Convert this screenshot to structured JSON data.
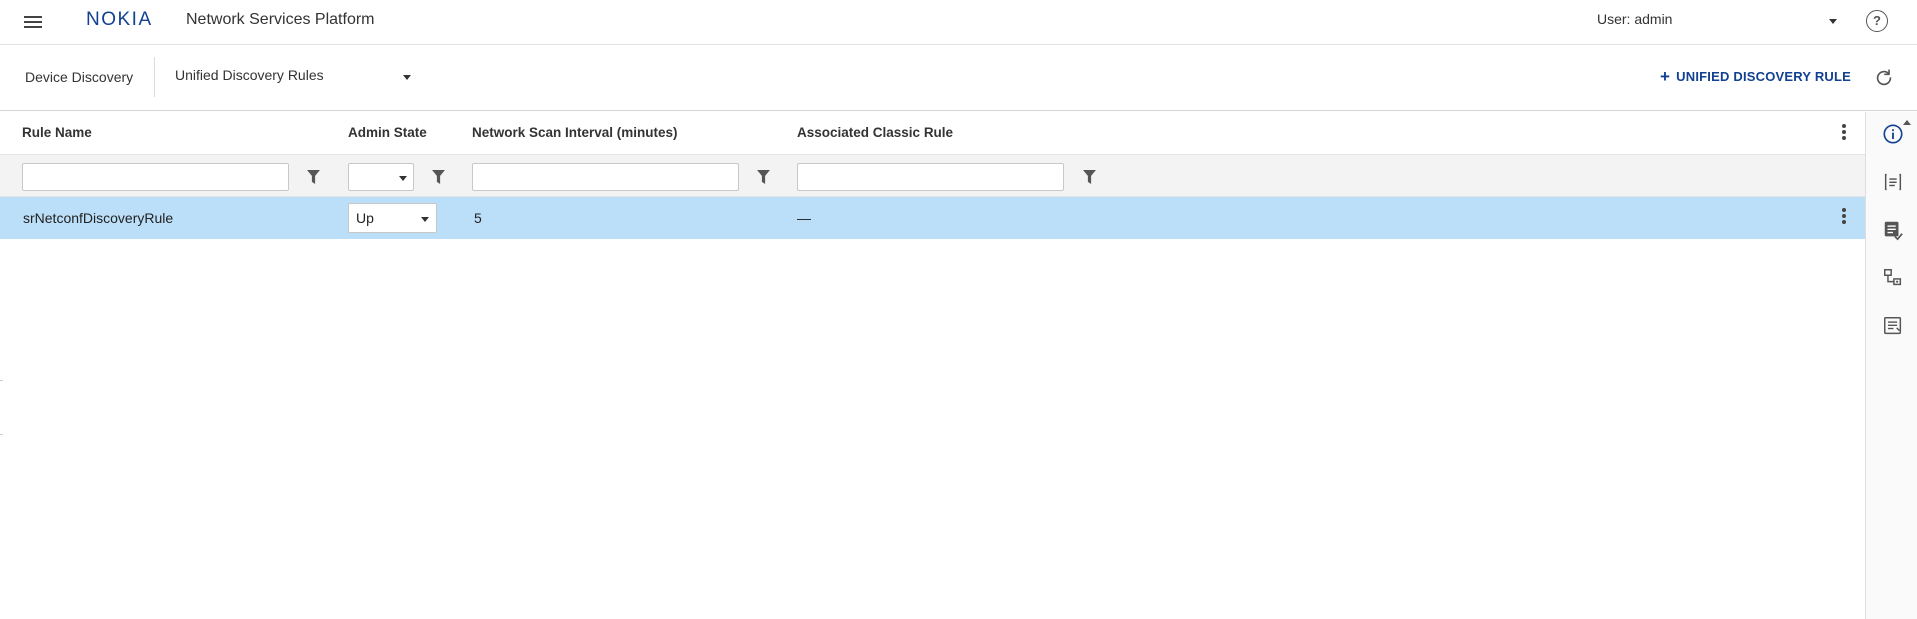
{
  "header": {
    "logo_text": "NOKIA",
    "app_title": "Network Services Platform",
    "user_label": "User: admin"
  },
  "toolbar": {
    "breadcrumb": "Device Discovery",
    "view_selected": "Unified Discovery Rules",
    "add_button_label": "UNIFIED DISCOVERY RULE"
  },
  "table": {
    "columns": [
      {
        "label": "Rule Name"
      },
      {
        "label": "Admin State"
      },
      {
        "label": "Network Scan Interval (minutes)"
      },
      {
        "label": "Associated Classic Rule"
      }
    ],
    "rows": [
      {
        "rule_name": "srNetconfDiscoveryRule",
        "admin_state": "Up",
        "scan_interval": "5",
        "classic_rule": "—"
      }
    ]
  },
  "icons": {
    "menu": "hamburger-menu-icon",
    "help": "help-circle-icon",
    "refresh": "refresh-icon",
    "filter": "funnel-icon",
    "more": "more-vertical-icon",
    "side_panel": [
      "info-icon",
      "list-details-icon",
      "checklist-icon",
      "hierarchy-icon",
      "notes-icon"
    ]
  },
  "colors": {
    "brand": "#124191",
    "selected_row": "#bbdff8",
    "filter_row_bg": "#f3f3f3"
  }
}
